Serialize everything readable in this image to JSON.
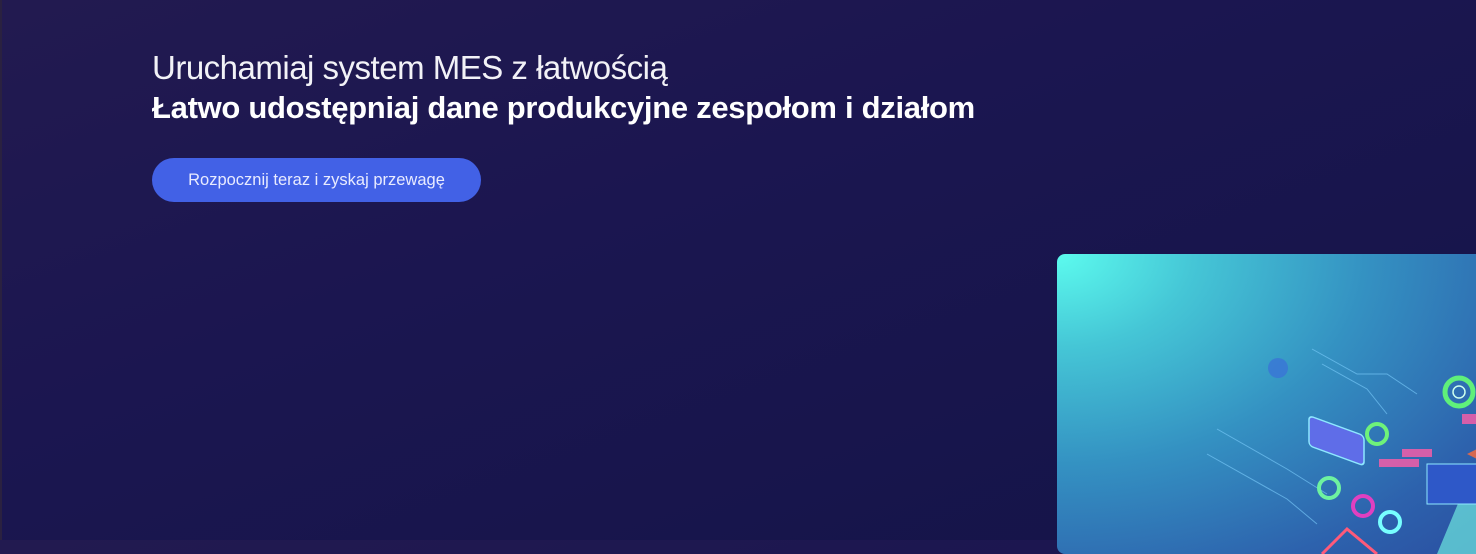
{
  "hero": {
    "subtitle": "Uruchamiaj system MES z łatwością",
    "title": "Łatwo udostępniaj dane produkcyjne zespołom i działom",
    "cta_label": "Rozpocznij teraz i zyskaj przewagę"
  },
  "colors": {
    "background": "#1b1650",
    "cta": "#4261e6",
    "card_accent": "#5cfbee"
  },
  "illustration": {
    "icon": "digital-manufacturing-illustration"
  }
}
